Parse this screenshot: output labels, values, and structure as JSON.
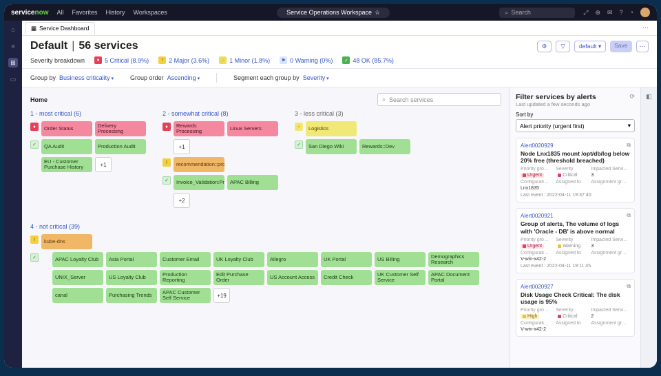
{
  "topnav": {
    "logo_a": "service",
    "logo_b": "now",
    "links": [
      "All",
      "Favorites",
      "History",
      "Workspaces"
    ],
    "workspace": "Service Operations Workspace",
    "search_placeholder": "Search"
  },
  "tab": {
    "label": "Service Dashboard"
  },
  "header": {
    "title": "Default",
    "count": "56 services",
    "breakdown_label": "Severity breakdown",
    "actions": {
      "default": "default ▾",
      "save": "Save"
    },
    "sev": {
      "critical": "5 Critical (8.9%)",
      "major": "2 Major (3.6%)",
      "minor": "1 Minor (1.8%)",
      "warning": "0 Warning (0%)",
      "ok": "48 OK (85.7%)"
    }
  },
  "controls": {
    "groupby_lbl": "Group by",
    "groupby_val": "Business criticality",
    "order_lbl": "Group order",
    "order_val": "Ascending",
    "segment_lbl": "Segment each group by",
    "segment_val": "Severity"
  },
  "board": {
    "home": "Home",
    "search_placeholder": "Search services",
    "col1": {
      "title": "1 - most critical (6)",
      "row1": [
        "Order Status",
        "Delivery Processing"
      ],
      "row2": [
        "QA Audit",
        "Production Audit"
      ],
      "row3": [
        "EU - Customer Purchase History"
      ],
      "more": "+1"
    },
    "col2": {
      "title": "2 - somewhat critical (8)",
      "row1": [
        "Rewards Processing",
        "Linux Servers"
      ],
      "more1": "+1",
      "row2": [
        "recommendation::prod"
      ],
      "row3": [
        "Invoice_Validation:Prod",
        "APAC Billing"
      ],
      "more2": "+2"
    },
    "col3": {
      "title": "3 - less critical (3)",
      "row1": [
        "Logistics"
      ],
      "row2": [
        "San Diego Wiki",
        "Rewards::Dev"
      ]
    },
    "sec4": {
      "title": "4 - not critical (39)",
      "orphan": "kube-dns",
      "cards": [
        "APAC Loyalty Club",
        "Asia Portal",
        "Customer Email",
        "UK Loyalty Club",
        "Allegro",
        "UK Portal",
        "US Billing",
        "Demographics Research",
        "UNIX_Server",
        "US Loyalty Club",
        "Production Reporting",
        "Edit Purchase Order",
        "US Account Access",
        "Credit Check",
        "UK Customer Self Service",
        "APAC Document Portal",
        "canal",
        "Purchasing Trends",
        "APAC Customer Self Service"
      ],
      "more": "+19"
    }
  },
  "panel": {
    "title": "Filter services by alerts",
    "sub": "Last updated a few seconds ago",
    "sort_lbl": "Sort by",
    "sort_val": "Alert priority (urgent first)",
    "alerts": [
      {
        "id": "Alert0020929",
        "title": "Node Lnx1835 mount /opt/db/log below 20% free (threshold breached)",
        "priority": "Urgent",
        "severity": "Critical",
        "impacted": "3",
        "config": "Lnx1835",
        "last": "Last event : 2022-04-11 19:37:40"
      },
      {
        "id": "Alert0020921",
        "title": "Group of alerts, The volume of logs with 'Oracle - DB' is above normal",
        "priority": "Urgent",
        "severity": "Warning",
        "impacted": "3",
        "config": "V-win-x42-2",
        "last": "Last event : 2022-04-11 19:11:45"
      },
      {
        "id": "Alert0020927",
        "title": "Disk Usage Check Critical: The disk usage is 95%",
        "priority": "High",
        "severity": "Critical",
        "impacted": "2",
        "config": "V-win-x42-2",
        "last": ""
      }
    ],
    "labels": {
      "priority": "Priority gro…",
      "severity": "Severity",
      "impacted": "Impacted Servi…",
      "config": "Configurati…",
      "assigned": "Assigned to",
      "group": "Assignment gr…"
    }
  }
}
